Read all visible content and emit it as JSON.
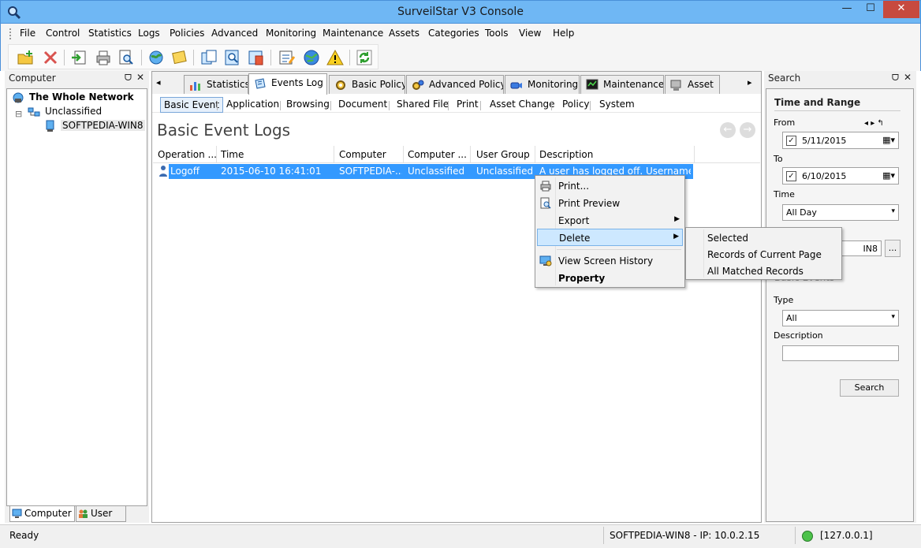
{
  "window": {
    "title": "SurveilStar V3 Console",
    "minimize": "—",
    "maximize": "☐",
    "close": "✕"
  },
  "menubar": [
    "File",
    "Control",
    "Statistics",
    "Logs",
    "Policies",
    "Advanced",
    "Monitoring",
    "Maintenance",
    "Assets",
    "Categories",
    "Tools",
    "View",
    "Help"
  ],
  "left_panel": {
    "title": "Computer",
    "pin": "ᗜ",
    "close": "✕",
    "tree": {
      "root": "The Whole Network",
      "group": "Unclassified",
      "computer": "SOFTPEDIA-WIN8",
      "expander": "⊟"
    },
    "bottom_tabs": [
      "Computer",
      "User"
    ]
  },
  "center": {
    "tabs": [
      "Statistics",
      "Events Log",
      "Basic Policy",
      "Advanced Policy",
      "Monitoring",
      "Maintenance",
      "Asset"
    ],
    "nav_left": "◂",
    "nav_right": "▸",
    "subtabs": [
      "Basic Event",
      "Application",
      "Browsing",
      "Document",
      "Shared File",
      "Print",
      "Asset Change",
      "Policy",
      "System"
    ],
    "page_title": "Basic Event Logs",
    "prev_arrow": "←",
    "next_arrow": "→",
    "columns": [
      "Operation ...",
      "Time",
      "Computer",
      "Computer ...",
      "User Group",
      "Description"
    ],
    "rows": [
      {
        "operation": "Logoff",
        "time": "2015-06-10 16:41:01",
        "computer": "SOFTPEDIA-...",
        "computer_group": "Unclassified",
        "user_group": "Unclassified",
        "description": "A user has logged off.  Username:..."
      }
    ]
  },
  "context_menu": {
    "items": [
      {
        "label": "Print...",
        "icon": "printer-icon"
      },
      {
        "label": "Print Preview",
        "icon": "print-preview-icon"
      },
      {
        "label": "Export",
        "submenu": true
      },
      {
        "label": "Delete",
        "submenu": true,
        "highlighted": true
      },
      {
        "label": "View Screen History",
        "icon": "screen-history-icon"
      },
      {
        "label": "Property",
        "bold": true
      }
    ],
    "submenu_arrow": "▶",
    "delete_submenu": [
      "Selected",
      "Records of Current Page",
      "All Matched Records"
    ]
  },
  "right_panel": {
    "title": "Search",
    "pin": "ᗜ",
    "close": "✕",
    "section_time": "Time and Range",
    "from_label": "From",
    "from_value": "5/11/2015",
    "to_label": "To",
    "to_value": "6/10/2015",
    "check_mark": "✓",
    "nav": "◂ ▸ ↰",
    "calendar": "▦▾",
    "time_label": "Time",
    "time_value": "All Day",
    "range_value": "IN8",
    "browse_button": "...",
    "section_basic": "Basic Events",
    "type_label": "Type",
    "type_value": "All",
    "description_label": "Description",
    "description_value": "",
    "dropdown_arrow": "▾",
    "search_button": "Search"
  },
  "statusbar": {
    "left": "Ready",
    "computer": "SOFTPEDIA-WIN8 - IP: 10.0.2.15",
    "server": "[127.0.0.1]"
  },
  "colors": {
    "title_bar": "#6fb7f4",
    "selection": "#3399ff",
    "menu_highlight": "#cde8ff",
    "close_button": "#c74a3f",
    "status_ok": "#4cc24a"
  }
}
